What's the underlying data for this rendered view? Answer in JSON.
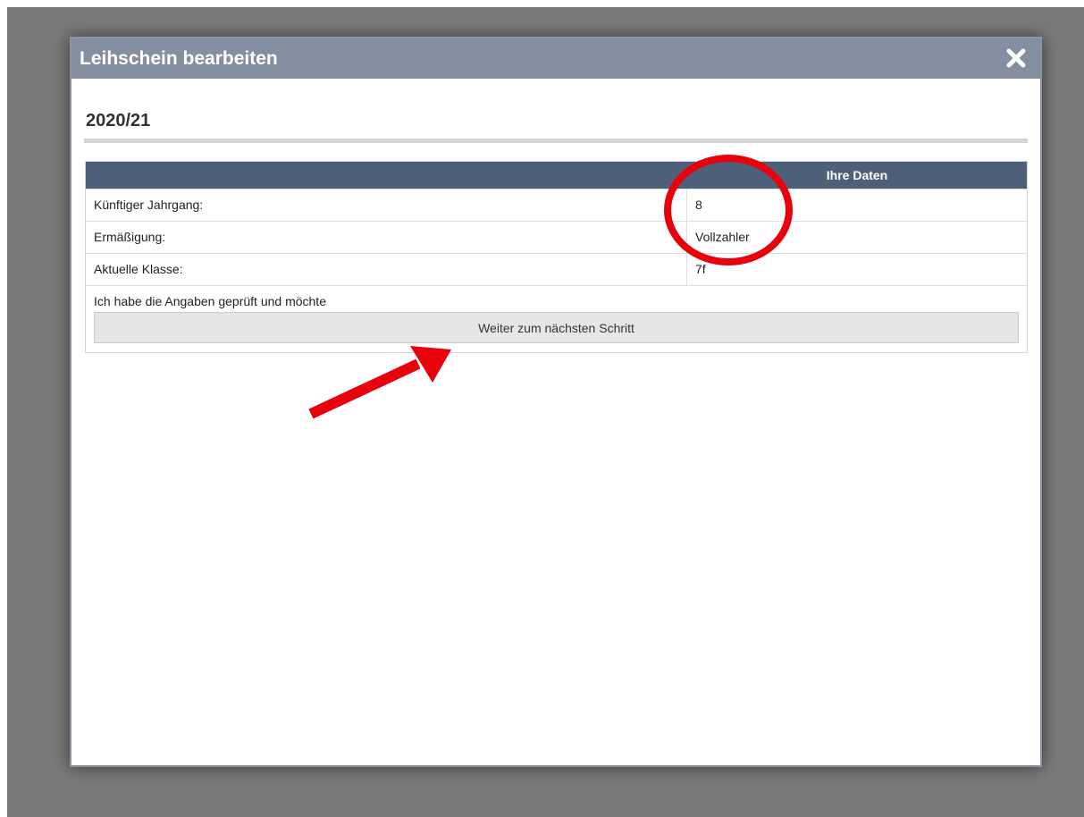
{
  "dialog": {
    "title": "Leihschein bearbeiten",
    "close_icon": "close-icon"
  },
  "section": {
    "title": "2020/21"
  },
  "table": {
    "header": "Ihre Daten",
    "rows": [
      {
        "label": "Künftiger Jahrgang:",
        "value": "8"
      },
      {
        "label": "Ermäßigung:",
        "value": "Vollzahler"
      },
      {
        "label": "Aktuelle Klasse:",
        "value": "7f"
      }
    ]
  },
  "confirm": {
    "text": "Ich habe die Angaben geprüft und möchte",
    "button_label": "Weiter zum nächsten Schritt"
  },
  "annotations": {
    "highlight_color": "#e8000d",
    "circle_icon": "highlight-circle",
    "arrow_icon": "pointer-arrow"
  }
}
